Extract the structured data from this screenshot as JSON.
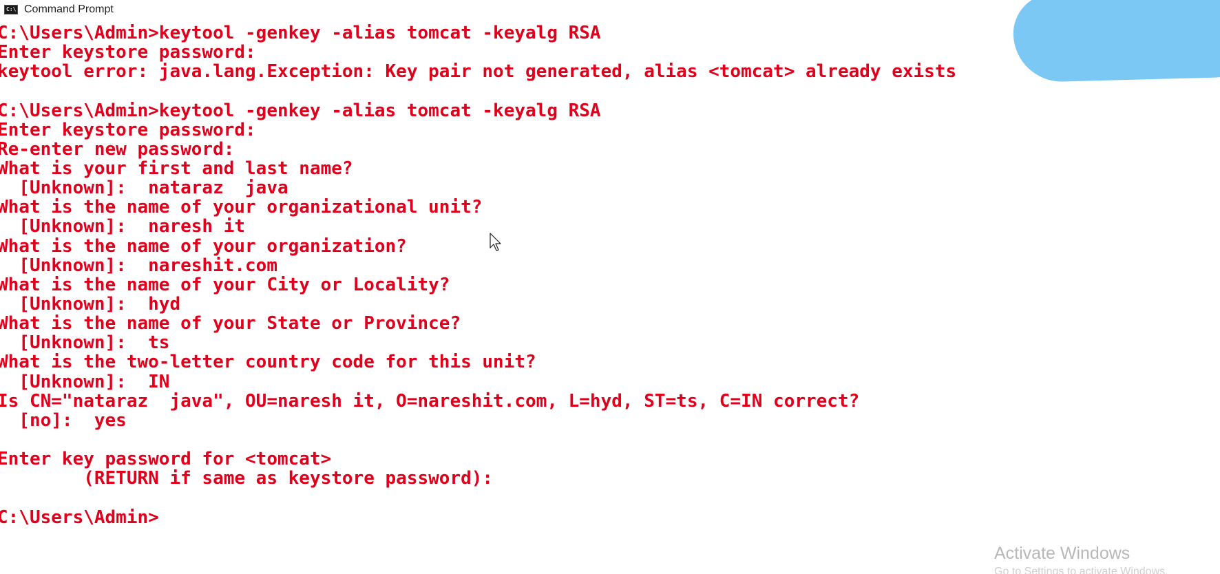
{
  "window": {
    "title": "Command Prompt",
    "icon_label": "C:\\"
  },
  "console": {
    "lines": [
      "C:\\Users\\Admin>keytool -genkey -alias tomcat -keyalg RSA",
      "Enter keystore password:",
      "keytool error: java.lang.Exception: Key pair not generated, alias <tomcat> already exists",
      "",
      "C:\\Users\\Admin>keytool -genkey -alias tomcat -keyalg RSA",
      "Enter keystore password:",
      "Re-enter new password:",
      "What is your first and last name?",
      "  [Unknown]:  nataraz  java",
      "What is the name of your organizational unit?",
      "  [Unknown]:  naresh it",
      "What is the name of your organization?",
      "  [Unknown]:  nareshit.com",
      "What is the name of your City or Locality?",
      "  [Unknown]:  hyd",
      "What is the name of your State or Province?",
      "  [Unknown]:  ts",
      "What is the two-letter country code for this unit?",
      "  [Unknown]:  IN",
      "Is CN=\"nataraz  java\", OU=naresh it, O=nareshit.com, L=hyd, ST=ts, C=IN correct?",
      "  [no]:  yes",
      "",
      "Enter key password for <tomcat>",
      "        (RETURN if same as keystore password):",
      "",
      "C:\\Users\\Admin>"
    ]
  },
  "watermark": {
    "title": "Activate Windows",
    "subtitle": "Go to Settings to activate Windows."
  },
  "colors": {
    "console_text": "#e0001b",
    "background": "#ffffff",
    "annotation_blob": "#7cc8f4"
  }
}
